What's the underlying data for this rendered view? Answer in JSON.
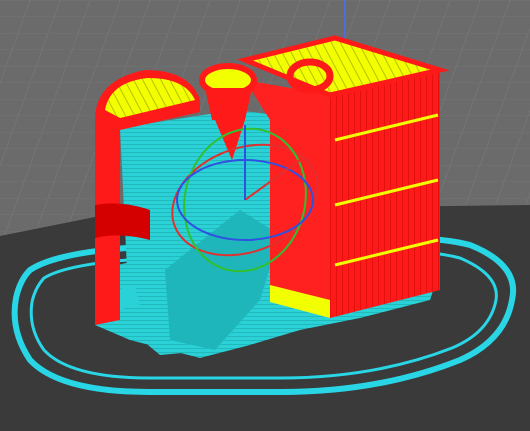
{
  "app": {
    "view": "slicer-preview-3d",
    "colors": {
      "background": "#6b6b6b",
      "grid_line": "#7a7a7a",
      "bed_dark": "#3a3a3a",
      "perimeter": "#ff1a1a",
      "perimeter_dark": "#d40000",
      "infill": "#f2ff00",
      "support": "#2ad1d6",
      "support_dark": "#1a9aa0",
      "skirt": "#29d6e6",
      "gizmo_red": "#e03030",
      "gizmo_green": "#30c030",
      "gizmo_blue": "#3050e0",
      "axis_blue": "#4a6cff"
    },
    "objects": [
      {
        "name": "print-object",
        "type": "box-with-spiral-and-ring"
      },
      {
        "name": "support-structure",
        "type": "support-material"
      },
      {
        "name": "skirt",
        "type": "skirt-loop"
      },
      {
        "name": "rotation-gizmo",
        "type": "gizmo"
      }
    ]
  }
}
